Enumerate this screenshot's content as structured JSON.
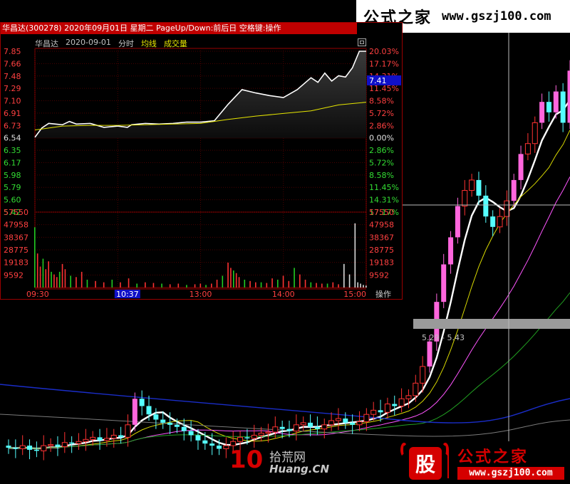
{
  "watermark_top": {
    "title": "公式之家",
    "url": "www.gszj100.com"
  },
  "watermark_bottom": {
    "title": "公式之家",
    "url": "www.gszj100.com",
    "badge_char": "股"
  },
  "watermark_mid": {
    "logo": "10",
    "cn": "拾荒网",
    "url": "Huang.CN"
  },
  "kline_overlay": {
    "price_range_label": "5.29 - 5.43"
  },
  "popup": {
    "title": "华昌达(300278) 2020年09月01日 星期二 PageUp/Down:前后日 空格键:操作",
    "stock_name": "华昌达",
    "date": "2020-09-01",
    "mode": "分时",
    "avg_label": "均线",
    "vol_label": "成交量",
    "price_ticks": [
      "7.85",
      "7.66",
      "7.48",
      "7.29",
      "7.10",
      "6.91",
      "6.73",
      "6.54",
      "6.35",
      "6.17",
      "5.98",
      "5.79",
      "5.60",
      "5.42"
    ],
    "pct_ticks": [
      "20.03%",
      "17.17%",
      "14.31%",
      "11.45%",
      "8.58%",
      "5.72%",
      "2.86%",
      "0.00%",
      "2.86%",
      "5.72%",
      "8.58%",
      "11.45%",
      "14.31%",
      "17.17%"
    ],
    "current_price": "7.41",
    "vol_ticks": [
      "57550",
      "47958",
      "38367",
      "28775",
      "19183",
      "9592"
    ],
    "time_ticks": [
      "09:30",
      "10:37",
      "13:00",
      "14:00",
      "15:00"
    ],
    "operate_label": "操作"
  },
  "chart_data": [
    {
      "type": "line",
      "title": "华昌达 2020-09-01 分时",
      "xlabel": "",
      "ylabel": "",
      "ylim": [
        5.42,
        7.85
      ],
      "y_ticks": [
        7.85,
        7.66,
        7.48,
        7.29,
        7.1,
        6.91,
        6.73,
        6.54,
        6.35,
        6.17,
        5.98,
        5.79,
        5.6,
        5.42
      ],
      "prev_close": 6.54,
      "x_ticks": [
        "09:30",
        "10:37",
        "13:00",
        "14:00",
        "15:00"
      ],
      "series": [
        {
          "name": "",
          "color": "#ffffff",
          "x": [
            0,
            5,
            10,
            15,
            20,
            25,
            30,
            40,
            50,
            60,
            67,
            70,
            75,
            80,
            90,
            100,
            110,
            120,
            130,
            140,
            150,
            160,
            170,
            180,
            190,
            200,
            205,
            210,
            215,
            220,
            225,
            230,
            235,
            240
          ],
          "y": [
            6.55,
            6.69,
            6.76,
            6.75,
            6.74,
            6.79,
            6.75,
            6.76,
            6.7,
            6.72,
            6.7,
            6.74,
            6.75,
            6.76,
            6.75,
            6.76,
            6.78,
            6.78,
            6.8,
            7.05,
            7.27,
            7.22,
            7.18,
            7.15,
            7.27,
            7.45,
            7.38,
            7.52,
            7.4,
            7.48,
            7.46,
            7.6,
            7.85,
            7.85
          ]
        },
        {
          "name": "均线",
          "color": "#e6e600",
          "x": [
            0,
            20,
            40,
            60,
            80,
            100,
            120,
            140,
            160,
            180,
            200,
            220,
            240
          ],
          "y": [
            6.66,
            6.72,
            6.73,
            6.73,
            6.74,
            6.75,
            6.76,
            6.82,
            6.87,
            6.91,
            6.95,
            7.04,
            7.08
          ]
        }
      ]
    },
    {
      "type": "bar",
      "title": "成交量",
      "ylim": [
        0,
        57550
      ],
      "y_ticks": [
        57550,
        47958,
        38367,
        28775,
        19183,
        9592
      ],
      "x": [
        0,
        2,
        4,
        6,
        8,
        10,
        12,
        14,
        16,
        18,
        20,
        22,
        26,
        30,
        34,
        38,
        44,
        50,
        56,
        62,
        68,
        74,
        80,
        86,
        92,
        98,
        104,
        110,
        116,
        120,
        124,
        128,
        132,
        136,
        140,
        142,
        144,
        146,
        148,
        152,
        156,
        160,
        164,
        168,
        172,
        176,
        180,
        184,
        188,
        192,
        196,
        200,
        204,
        208,
        212,
        216,
        220,
        224,
        228,
        232,
        234,
        236,
        238,
        240
      ],
      "values": [
        46000,
        26000,
        16000,
        22000,
        14000,
        20000,
        12000,
        10000,
        8000,
        12000,
        18000,
        14000,
        9000,
        8000,
        12000,
        6000,
        5000,
        4000,
        6000,
        4000,
        7000,
        3000,
        4000,
        3500,
        3000,
        2500,
        3000,
        2000,
        2500,
        3000,
        2000,
        3000,
        6000,
        9000,
        19000,
        15000,
        13000,
        11000,
        8000,
        6000,
        5000,
        4000,
        4000,
        3500,
        7000,
        6000,
        9000,
        5000,
        15000,
        10000,
        6000,
        4000,
        3500,
        3000,
        3000,
        4000,
        2500,
        18000,
        10000,
        49000,
        4000,
        3000,
        2000,
        1500
      ]
    },
    {
      "type": "candlestick",
      "title": "",
      "series": [
        {
          "name": "kline",
          "x": [
            0,
            1,
            2,
            3,
            4,
            5,
            6,
            7,
            8,
            9,
            10,
            11,
            12,
            13,
            14,
            15,
            16,
            17,
            18,
            19,
            20,
            21,
            22,
            23,
            24,
            25,
            26,
            27,
            28,
            29,
            30,
            31,
            32,
            33,
            34,
            35,
            36,
            37,
            38,
            39,
            40,
            41,
            42,
            43,
            44,
            45,
            46,
            47,
            48,
            49,
            50,
            51,
            52,
            53,
            54,
            55,
            56,
            57,
            58,
            59,
            60,
            61,
            62,
            63,
            64,
            65,
            66,
            67,
            68,
            69,
            70,
            71,
            72,
            73,
            74,
            75,
            76,
            77,
            78,
            79,
            80
          ],
          "open": [
            5.0,
            4.98,
            4.97,
            5.0,
            4.96,
            4.95,
            5.0,
            5.01,
            4.99,
            5.03,
            5.02,
            5.04,
            5.06,
            5.08,
            5.05,
            5.07,
            5.1,
            5.08,
            5.2,
            5.45,
            5.38,
            5.3,
            5.25,
            5.22,
            5.2,
            5.18,
            5.14,
            5.1,
            5.05,
            5.02,
            5.0,
            4.97,
            5.0,
            5.04,
            5.08,
            5.07,
            5.1,
            5.12,
            5.13,
            5.18,
            5.16,
            5.14,
            5.2,
            5.22,
            5.18,
            5.16,
            5.2,
            5.24,
            5.26,
            5.22,
            5.2,
            5.23,
            5.3,
            5.34,
            5.32,
            5.4,
            5.38,
            5.45,
            5.48,
            5.6,
            5.76,
            6.0,
            6.38,
            6.74,
            7.0,
            7.3,
            7.45,
            7.55,
            7.4,
            7.2,
            7.1,
            7.2,
            7.35,
            7.55,
            7.8,
            7.9,
            8.1,
            8.3,
            8.2,
            8.4,
            8.1
          ],
          "close": [
            4.98,
            4.97,
            5.0,
            4.96,
            4.95,
            5.0,
            5.01,
            4.99,
            5.03,
            5.02,
            5.04,
            5.06,
            5.08,
            5.05,
            5.07,
            5.1,
            5.08,
            5.2,
            5.45,
            5.38,
            5.3,
            5.25,
            5.22,
            5.2,
            5.18,
            5.14,
            5.1,
            5.05,
            5.02,
            5.0,
            4.97,
            5.0,
            5.04,
            5.08,
            5.07,
            5.1,
            5.12,
            5.13,
            5.18,
            5.16,
            5.14,
            5.2,
            5.22,
            5.18,
            5.16,
            5.2,
            5.24,
            5.26,
            5.22,
            5.2,
            5.23,
            5.3,
            5.34,
            5.32,
            5.4,
            5.38,
            5.45,
            5.48,
            5.6,
            5.76,
            6.0,
            6.38,
            6.74,
            7.0,
            7.3,
            7.45,
            7.55,
            7.4,
            7.2,
            7.1,
            7.2,
            7.35,
            7.55,
            7.8,
            7.9,
            8.1,
            8.3,
            8.2,
            8.4,
            8.1,
            8.6
          ]
        }
      ]
    }
  ]
}
